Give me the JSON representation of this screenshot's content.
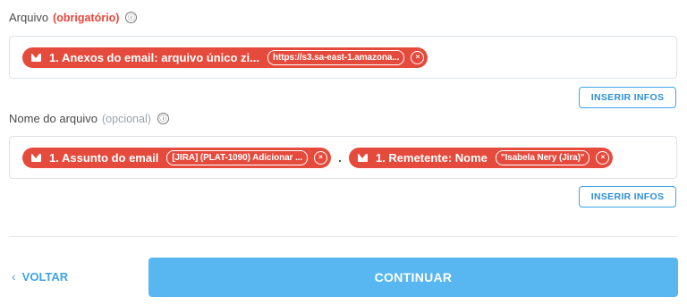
{
  "file_field": {
    "label": "Arquivo",
    "required_tag": "(obrigatório)",
    "info_icon": "ⓘ",
    "pill": {
      "icon": "mail-icon",
      "text": "1. Anexos do email: arquivo único zi...",
      "value": "https://s3.sa-east-1.amazona...",
      "remove": "×"
    },
    "insert_button": "INSERIR INFOS"
  },
  "filename_field": {
    "label": "Nome do arquivo",
    "optional_tag": "(opcional)",
    "info_icon": "ⓘ",
    "pill1": {
      "icon": "mail-icon",
      "text": "1. Assunto do email",
      "value": "[JIRA] (PLAT-1090) Adicionar ...",
      "remove": "×"
    },
    "separator": ".",
    "pill2": {
      "icon": "mail-icon",
      "text": "1. Remetente: Nome",
      "value": "\"Isabela Nery (Jira)\"",
      "remove": "×"
    },
    "insert_button": "INSERIR INFOS"
  },
  "footer": {
    "back_chevron": "‹",
    "back_label": "VOLTAR",
    "continue_label": "CONTINUAR"
  },
  "colors": {
    "pill_red": "#e54b3d",
    "accent_blue": "#3fa4e6",
    "continue_blue": "#58b7f1"
  }
}
